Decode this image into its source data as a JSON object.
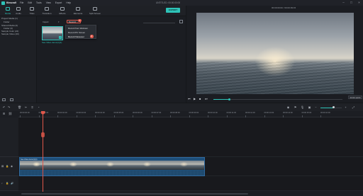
{
  "app": {
    "logo_text": "filmora9",
    "title": "UNTITLED: 00:00:00:00"
  },
  "menu": [
    "File",
    "Edit",
    "Tools",
    "View",
    "Export",
    "Help"
  ],
  "toolbar": {
    "tools": [
      {
        "label": "Media",
        "icon": "media-icon"
      },
      {
        "label": "Audio",
        "icon": "audio-icon"
      },
      {
        "label": "Titles",
        "icon": "titles-icon"
      },
      {
        "label": "Transition",
        "icon": "transition-icon"
      },
      {
        "label": "Effects",
        "icon": "effects-icon"
      },
      {
        "label": "Elements",
        "icon": "elements-icon"
      },
      {
        "label": "Split Screen",
        "icon": "split-screen-icon"
      }
    ],
    "export_label": "EXPORT"
  },
  "sidebar": {
    "items": [
      "Project Media (1)",
      "Folder",
      "Shared Media (0)",
      "Folder (0)",
      "Sample Color (22)",
      "Sample Video (20)"
    ]
  },
  "media": {
    "filter_label": "Import",
    "record_label": "Record",
    "record_menu": [
      "Record from Webcam",
      "Record PC Screen",
      "Record Voiceover"
    ],
    "badge_menu": "2",
    "badge_button": "1",
    "thumb_name": "Sea Video.demo(1)(1)"
  },
  "preview": {
    "timecode": "00:00:00:00 / 00:00:09:15",
    "ratio_label": "00:00:12/20",
    "controls": [
      "⏮",
      "▶",
      "■",
      "⏭"
    ]
  },
  "timeline": {
    "ruler_ticks": [
      "00:00:00:00",
      "00:00:01:00",
      "00:00:02:00",
      "00:00:03:00",
      "00:00:04:00",
      "00:00:05:00",
      "00:00:06:00",
      "00:00:07:00",
      "00:00:08:00",
      "00:00:09:00",
      "00:00:10:00",
      "00:00:11:00",
      "00:00:12:00",
      "00:00:13:00",
      "00:00:14:00",
      "00:00:15:00",
      "00:00:16:00"
    ],
    "clip_title": "Sea Video.demo(1)(1)",
    "zoom_level": 0.6
  },
  "colors": {
    "accent": "#2ec3b8",
    "playhead": "#e0574a",
    "clip": "#1e4f7a"
  }
}
